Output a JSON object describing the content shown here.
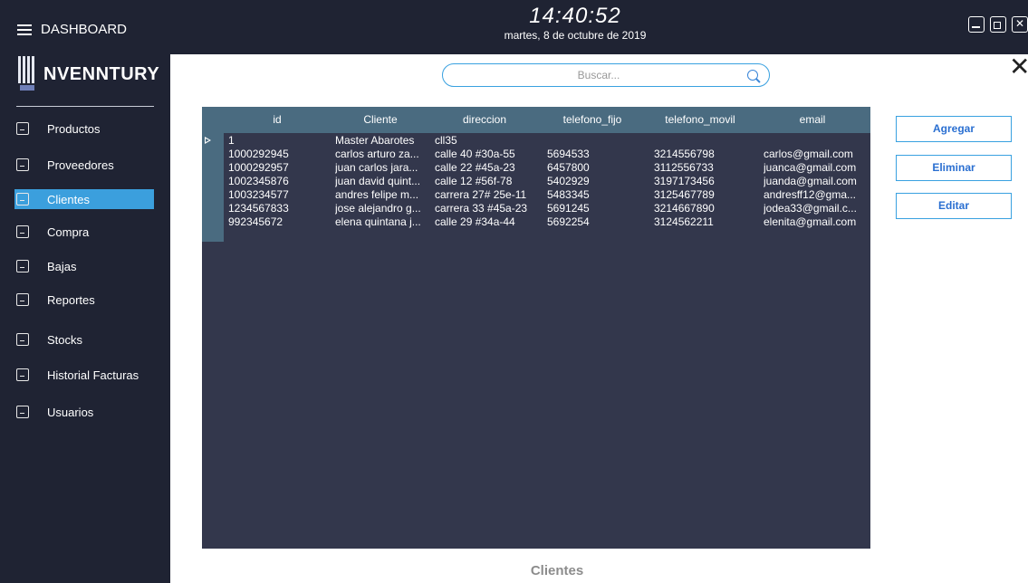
{
  "header": {
    "dashboard_label": "DASHBOARD",
    "time": "14:40:52",
    "date": "martes, 8 de octubre de 2019"
  },
  "brand": {
    "logo_text": "NVENNTURY"
  },
  "sidebar": {
    "items": [
      {
        "label": "Productos",
        "icon": "product-icon"
      },
      {
        "label": "Proveedores",
        "icon": "suppliers-icon"
      },
      {
        "label": "Clientes",
        "icon": "clients-icon",
        "active": true
      },
      {
        "label": "Compra",
        "icon": "purchase-icon"
      },
      {
        "label": "Bajas",
        "icon": "removals-icon"
      },
      {
        "label": "Reportes",
        "icon": "reports-icon"
      },
      {
        "label": "Stocks",
        "icon": "stocks-icon"
      },
      {
        "label": "Historial Facturas",
        "icon": "invoice-history-icon"
      },
      {
        "label": "Usuarios",
        "icon": "users-icon"
      }
    ]
  },
  "search": {
    "placeholder": "Buscar..."
  },
  "table": {
    "columns": [
      "id",
      "Cliente",
      "direccion",
      "telefono_fijo",
      "telefono_movil",
      "email"
    ],
    "rows": [
      [
        "1",
        "Master Abarotes",
        "cll35",
        "",
        "",
        ""
      ],
      [
        "1000292945",
        "carlos arturo za...",
        "calle 40 #30a-55",
        "5694533",
        "3214556798",
        "carlos@gmail.com"
      ],
      [
        "1000292957",
        "juan carlos jara...",
        "calle 22 #45a-23",
        "6457800",
        "3112556733",
        "juanca@gmail.com"
      ],
      [
        "1002345876",
        "juan david quint...",
        "calle 12 #56f-78",
        "5402929",
        "3197173456",
        "juanda@gmail.com"
      ],
      [
        "1003234577",
        "andres felipe m...",
        "carrera 27# 25e-11",
        "5483345",
        "3125467789",
        "andresff12@gma..."
      ],
      [
        "1234567833",
        "jose alejandro g...",
        "carrera 33 #45a-23",
        "5691245",
        "3214667890",
        "jodea33@gmail.c..."
      ],
      [
        "992345672",
        "elena quintana j...",
        "calle 29 #34a-44",
        "5692254",
        "3124562211",
        "elenita@gmail.com"
      ]
    ]
  },
  "actions": {
    "add": "Agregar",
    "delete": "Eliminar",
    "edit": "Editar"
  },
  "footer": {
    "label": "Clientes"
  },
  "colors": {
    "sidebar_bg": "#1f2333",
    "grid_bg": "#33374c",
    "grid_header": "#4a6b80",
    "accent": "#3b9fdd"
  }
}
